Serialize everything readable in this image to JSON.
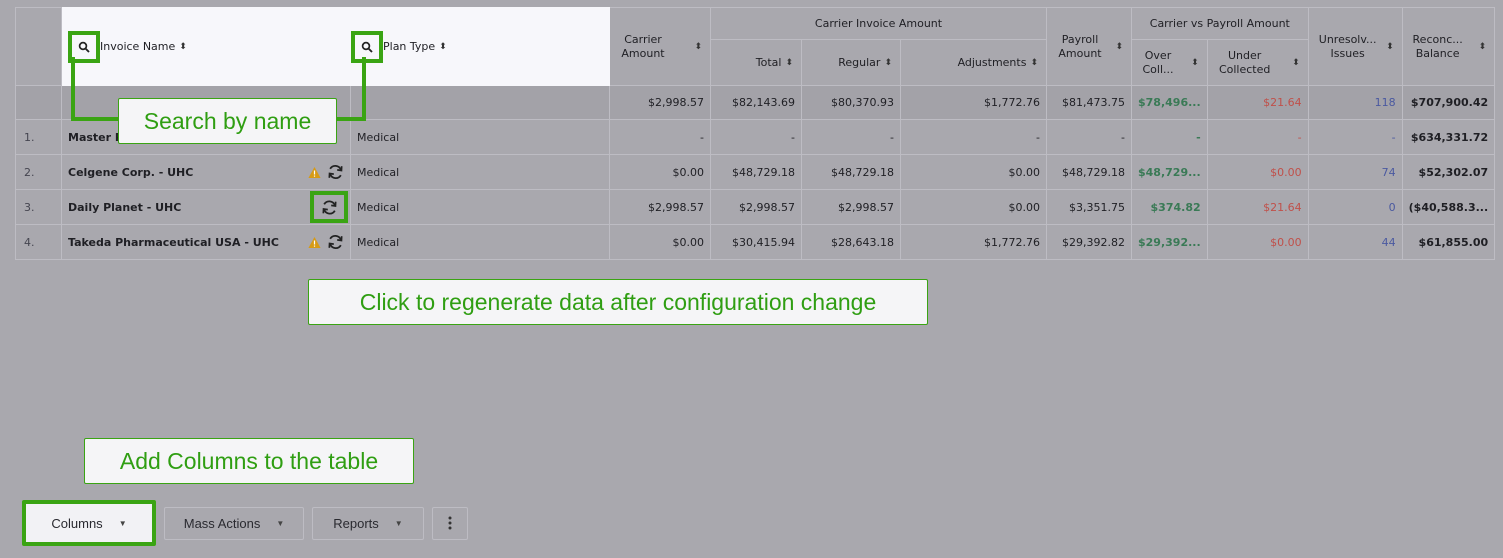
{
  "header": {
    "invoice_name": "Invoice Name",
    "plan_type": "Plan Type",
    "carrier_amount": "Carrier Amount",
    "carrier_invoice_amount": "Carrier Invoice Amount",
    "total": "Total",
    "regular": "Regular",
    "adjustments": "Adjustments",
    "payroll_amount": "Payroll Amount",
    "carrier_vs_payroll": "Carrier vs Payroll Amount",
    "over_collected": "Over Coll...",
    "under_collected": "Under Collected",
    "unresolved_issues": "Unresolv... Issues",
    "reconciled_balance": "Reconc... Balance"
  },
  "summary": {
    "carrier_amount": "$2,998.57",
    "total": "$82,143.69",
    "regular": "$80,370.93",
    "adjustments": "$1,772.76",
    "payroll": "$81,473.75",
    "over": "$78,496...",
    "under": "$21.64",
    "issues": "118",
    "balance": "$707,900.42"
  },
  "rows": [
    {
      "idx": "1.",
      "name": "Master P",
      "plan": "Medical",
      "carrier": "-",
      "total": "-",
      "regular": "-",
      "adj": "-",
      "payroll": "-",
      "over": "-",
      "under": "-",
      "issues": "-",
      "balance": "$634,331.72"
    },
    {
      "idx": "2.",
      "name": "Celgene Corp. - UHC",
      "plan": "Medical",
      "carrier": "$0.00",
      "total": "$48,729.18",
      "regular": "$48,729.18",
      "adj": "$0.00",
      "payroll": "$48,729.18",
      "over": "$48,729...",
      "under": "$0.00",
      "issues": "74",
      "balance": "$52,302.07"
    },
    {
      "idx": "3.",
      "name": "Daily Planet - UHC",
      "plan": "Medical",
      "carrier": "$2,998.57",
      "total": "$2,998.57",
      "regular": "$2,998.57",
      "adj": "$0.00",
      "payroll": "$3,351.75",
      "over": "$374.82",
      "under": "$21.64",
      "issues": "0",
      "balance": "($40,588.3..."
    },
    {
      "idx": "4.",
      "name": "Takeda Pharmaceutical USA - UHC",
      "plan": "Medical",
      "carrier": "$0.00",
      "total": "$30,415.94",
      "regular": "$28,643.18",
      "adj": "$1,772.76",
      "payroll": "$29,392.82",
      "over": "$29,392...",
      "under": "$0.00",
      "issues": "44",
      "balance": "$61,855.00"
    }
  ],
  "callouts": {
    "search": "Search by name",
    "regenerate": "Click to regenerate data after configuration change",
    "columns": "Add Columns to the table"
  },
  "toolbar": {
    "columns": "Columns",
    "mass_actions": "Mass Actions",
    "reports": "Reports"
  },
  "colors": {
    "highlight": "#3aa413",
    "positive": "#3a7a56",
    "negative": "#c0504a",
    "issues": "#4a59a0"
  }
}
